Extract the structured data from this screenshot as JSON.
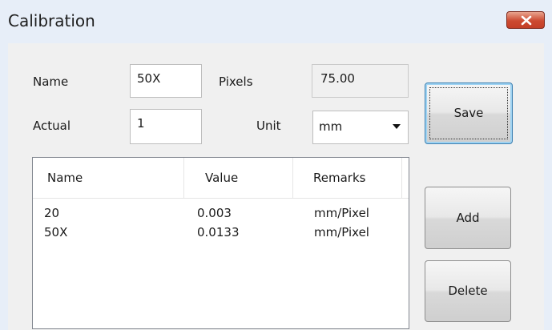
{
  "window": {
    "title": "Calibration"
  },
  "form": {
    "name_label": "Name",
    "name_value": "50X",
    "pixels_label": "Pixels",
    "pixels_value": "75.00",
    "actual_label": "Actual",
    "actual_value": "1",
    "unit_label": "Unit",
    "unit_value": "mm"
  },
  "buttons": {
    "save": "Save",
    "add": "Add",
    "delete": "Delete"
  },
  "table": {
    "columns": [
      "Name",
      "Value",
      "Remarks"
    ],
    "rows": [
      {
        "name": "20",
        "value": "0.003",
        "remarks": "mm/Pixel"
      },
      {
        "name": "50X",
        "value": "0.0133",
        "remarks": "mm/Pixel"
      }
    ]
  },
  "colors": {
    "close_button": "#cc4a31",
    "titlebar": "#e7eef8",
    "default_button_border": "#3c7fb1"
  },
  "icons": {
    "close": "close-x-icon",
    "dropdown": "chevron-down-icon"
  }
}
